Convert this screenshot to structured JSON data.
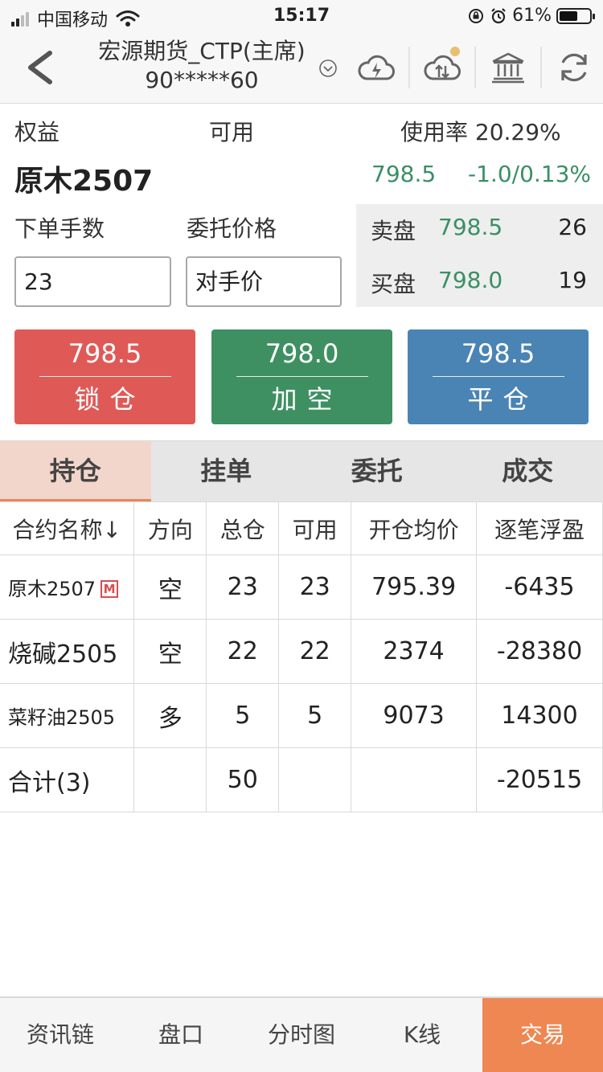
{
  "status": {
    "carrier": "中国移动",
    "time": "15:17",
    "battery": "61%",
    "battery_level": 0.61
  },
  "nav": {
    "title": "宏源期货_CTP(主席)",
    "account": "90*****60"
  },
  "info": {
    "equity_label": "权益",
    "available_label": "可用",
    "usage_label": "使用率 20.29%",
    "contract": "原木2507",
    "last_price": "798.5",
    "change": "-1.0/0.13%",
    "lots_label": "下单手数",
    "price_label": "委托价格",
    "lots_value": "23",
    "price_value": "对手价"
  },
  "book": {
    "ask_label": "卖盘",
    "ask_price": "798.5",
    "ask_volume": "26",
    "bid_label": "买盘",
    "bid_price": "798.0",
    "bid_volume": "19"
  },
  "actions": {
    "lock_price": "798.5",
    "lock_label": "锁仓",
    "add_price": "798.0",
    "add_label": "加空",
    "close_price": "798.5",
    "close_label": "平仓"
  },
  "tabs": [
    "持仓",
    "挂单",
    "委托",
    "成交"
  ],
  "table": {
    "headers": [
      "合约名称↓",
      "方向",
      "总仓",
      "可用",
      "开仓均价",
      "逐笔浮盈"
    ],
    "rows": [
      {
        "name": "原木2507",
        "badge": "M",
        "dir": "空",
        "total": "23",
        "avail": "23",
        "avg": "795.39",
        "pnl": "-6435"
      },
      {
        "name": "烧碱2505",
        "dir": "空",
        "total": "22",
        "avail": "22",
        "avg": "2374",
        "pnl": "-28380"
      },
      {
        "name": "菜籽油2505",
        "dir": "多",
        "total": "5",
        "avail": "5",
        "avg": "9073",
        "pnl": "14300"
      }
    ],
    "summary": {
      "label": "合计(3)",
      "total": "50",
      "pnl": "-20515"
    }
  },
  "bottom_nav": [
    "资讯链",
    "盘口",
    "分时图",
    "K线",
    "交易"
  ],
  "colors": {
    "accent": "#ee8752",
    "up_red": "#d94d4d",
    "down_green": "#3a8f64",
    "lock_btn": "#df5a57",
    "add_btn": "#3e9062",
    "close_btn": "#4a84b4"
  }
}
